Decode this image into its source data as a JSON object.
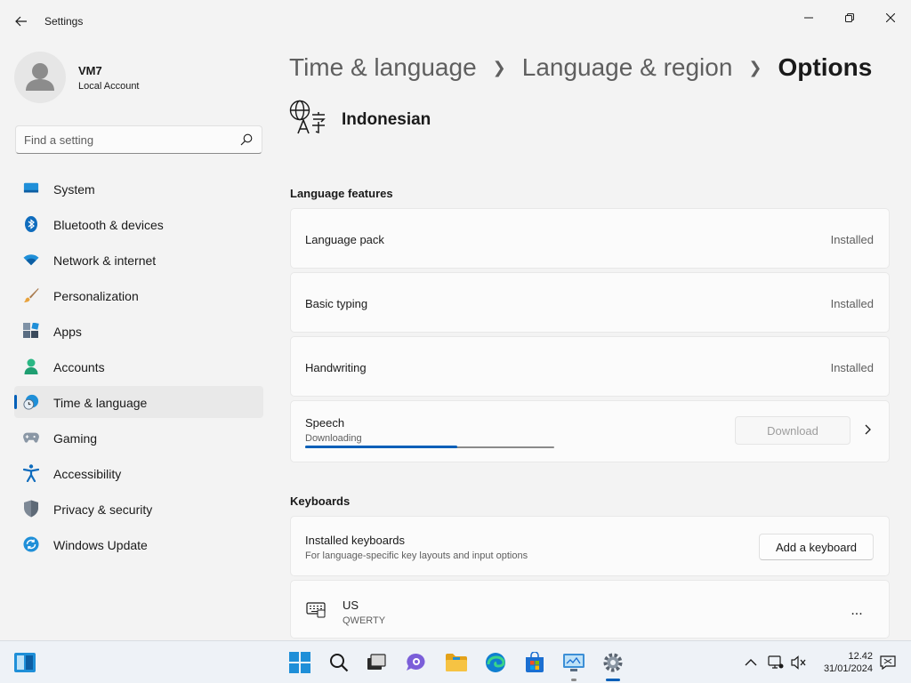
{
  "window": {
    "title": "Settings"
  },
  "profile": {
    "name": "VM7",
    "account_type": "Local Account"
  },
  "search": {
    "placeholder": "Find a setting"
  },
  "nav": {
    "items": [
      {
        "label": "System",
        "icon": "system-icon",
        "selected": false
      },
      {
        "label": "Bluetooth & devices",
        "icon": "bluetooth-icon",
        "selected": false
      },
      {
        "label": "Network & internet",
        "icon": "wifi-icon",
        "selected": false
      },
      {
        "label": "Personalization",
        "icon": "brush-icon",
        "selected": false
      },
      {
        "label": "Apps",
        "icon": "apps-icon",
        "selected": false
      },
      {
        "label": "Accounts",
        "icon": "accounts-icon",
        "selected": false
      },
      {
        "label": "Time & language",
        "icon": "time-language-icon",
        "selected": true
      },
      {
        "label": "Gaming",
        "icon": "gamepad-icon",
        "selected": false
      },
      {
        "label": "Accessibility",
        "icon": "accessibility-icon",
        "selected": false
      },
      {
        "label": "Privacy & security",
        "icon": "shield-icon",
        "selected": false
      },
      {
        "label": "Windows Update",
        "icon": "update-icon",
        "selected": false
      }
    ]
  },
  "breadcrumb": {
    "items": [
      "Time & language",
      "Language & region"
    ],
    "current": "Options"
  },
  "language": {
    "name": "Indonesian"
  },
  "language_features": {
    "title": "Language features",
    "items": [
      {
        "label": "Language pack",
        "status": "Installed"
      },
      {
        "label": "Basic typing",
        "status": "Installed"
      },
      {
        "label": "Handwriting",
        "status": "Installed"
      }
    ],
    "speech": {
      "label": "Speech",
      "status": "Downloading",
      "progress_fraction": 0.61,
      "button_label": "Download"
    }
  },
  "keyboards": {
    "title": "Keyboards",
    "installed_title": "Installed keyboards",
    "installed_sub": "For language-specific key layouts and input options",
    "add_button": "Add a keyboard",
    "items": [
      {
        "name": "US",
        "layout": "QWERTY",
        "more": "..."
      }
    ]
  },
  "taskbar": {
    "time": "12.42",
    "date": "31/01/2024"
  },
  "colors": {
    "accent": "#005fb8",
    "background": "#f3f3f3",
    "card": "#fbfbfb"
  }
}
